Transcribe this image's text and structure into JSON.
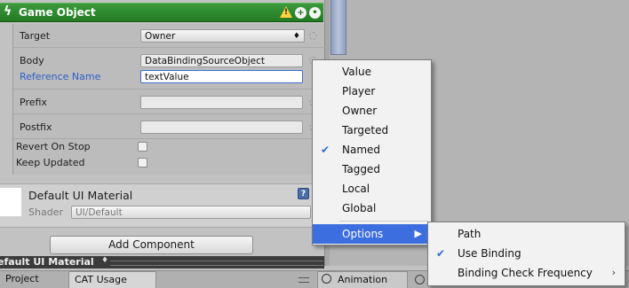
{
  "header": {
    "title": "Game Object",
    "icons": [
      "warning-icon",
      "add-icon",
      "settings-icon"
    ]
  },
  "fields": {
    "target_label": "Target",
    "target_value": "Owner",
    "body_label": "Body",
    "body_value": "DataBindingSourceObject",
    "refname_label": "Reference Name",
    "refname_value": "textValue",
    "prefix_label": "Prefix",
    "prefix_value": "",
    "postfix_label": "Postfix",
    "postfix_value": "",
    "revert_label": "Revert On Stop",
    "revert_checked": false,
    "keep_label": "Keep Updated",
    "keep_checked": false
  },
  "material": {
    "name": "Default UI Material",
    "shader_label": "Shader",
    "shader_value": "UI/Default"
  },
  "add_component_label": "Add Component",
  "inner_bar_title": "efault UI Material",
  "tabs": {
    "project": "Project",
    "cat": "CAT Usage",
    "animation": "Animation"
  },
  "main_menu": {
    "items": [
      "Value",
      "Player",
      "Owner",
      "Targeted",
      "Named",
      "Tagged",
      "Local",
      "Global"
    ],
    "checked_item": "Named",
    "options_label": "Options"
  },
  "options_menu": {
    "items": [
      "Path",
      "Use Binding",
      "Binding Check Frequency"
    ],
    "checked_item": "Use Binding"
  },
  "colors": {
    "header_green": "#2f8a2f",
    "highlight": "#3d6ee0",
    "link_blue": "#2f5fc7"
  }
}
